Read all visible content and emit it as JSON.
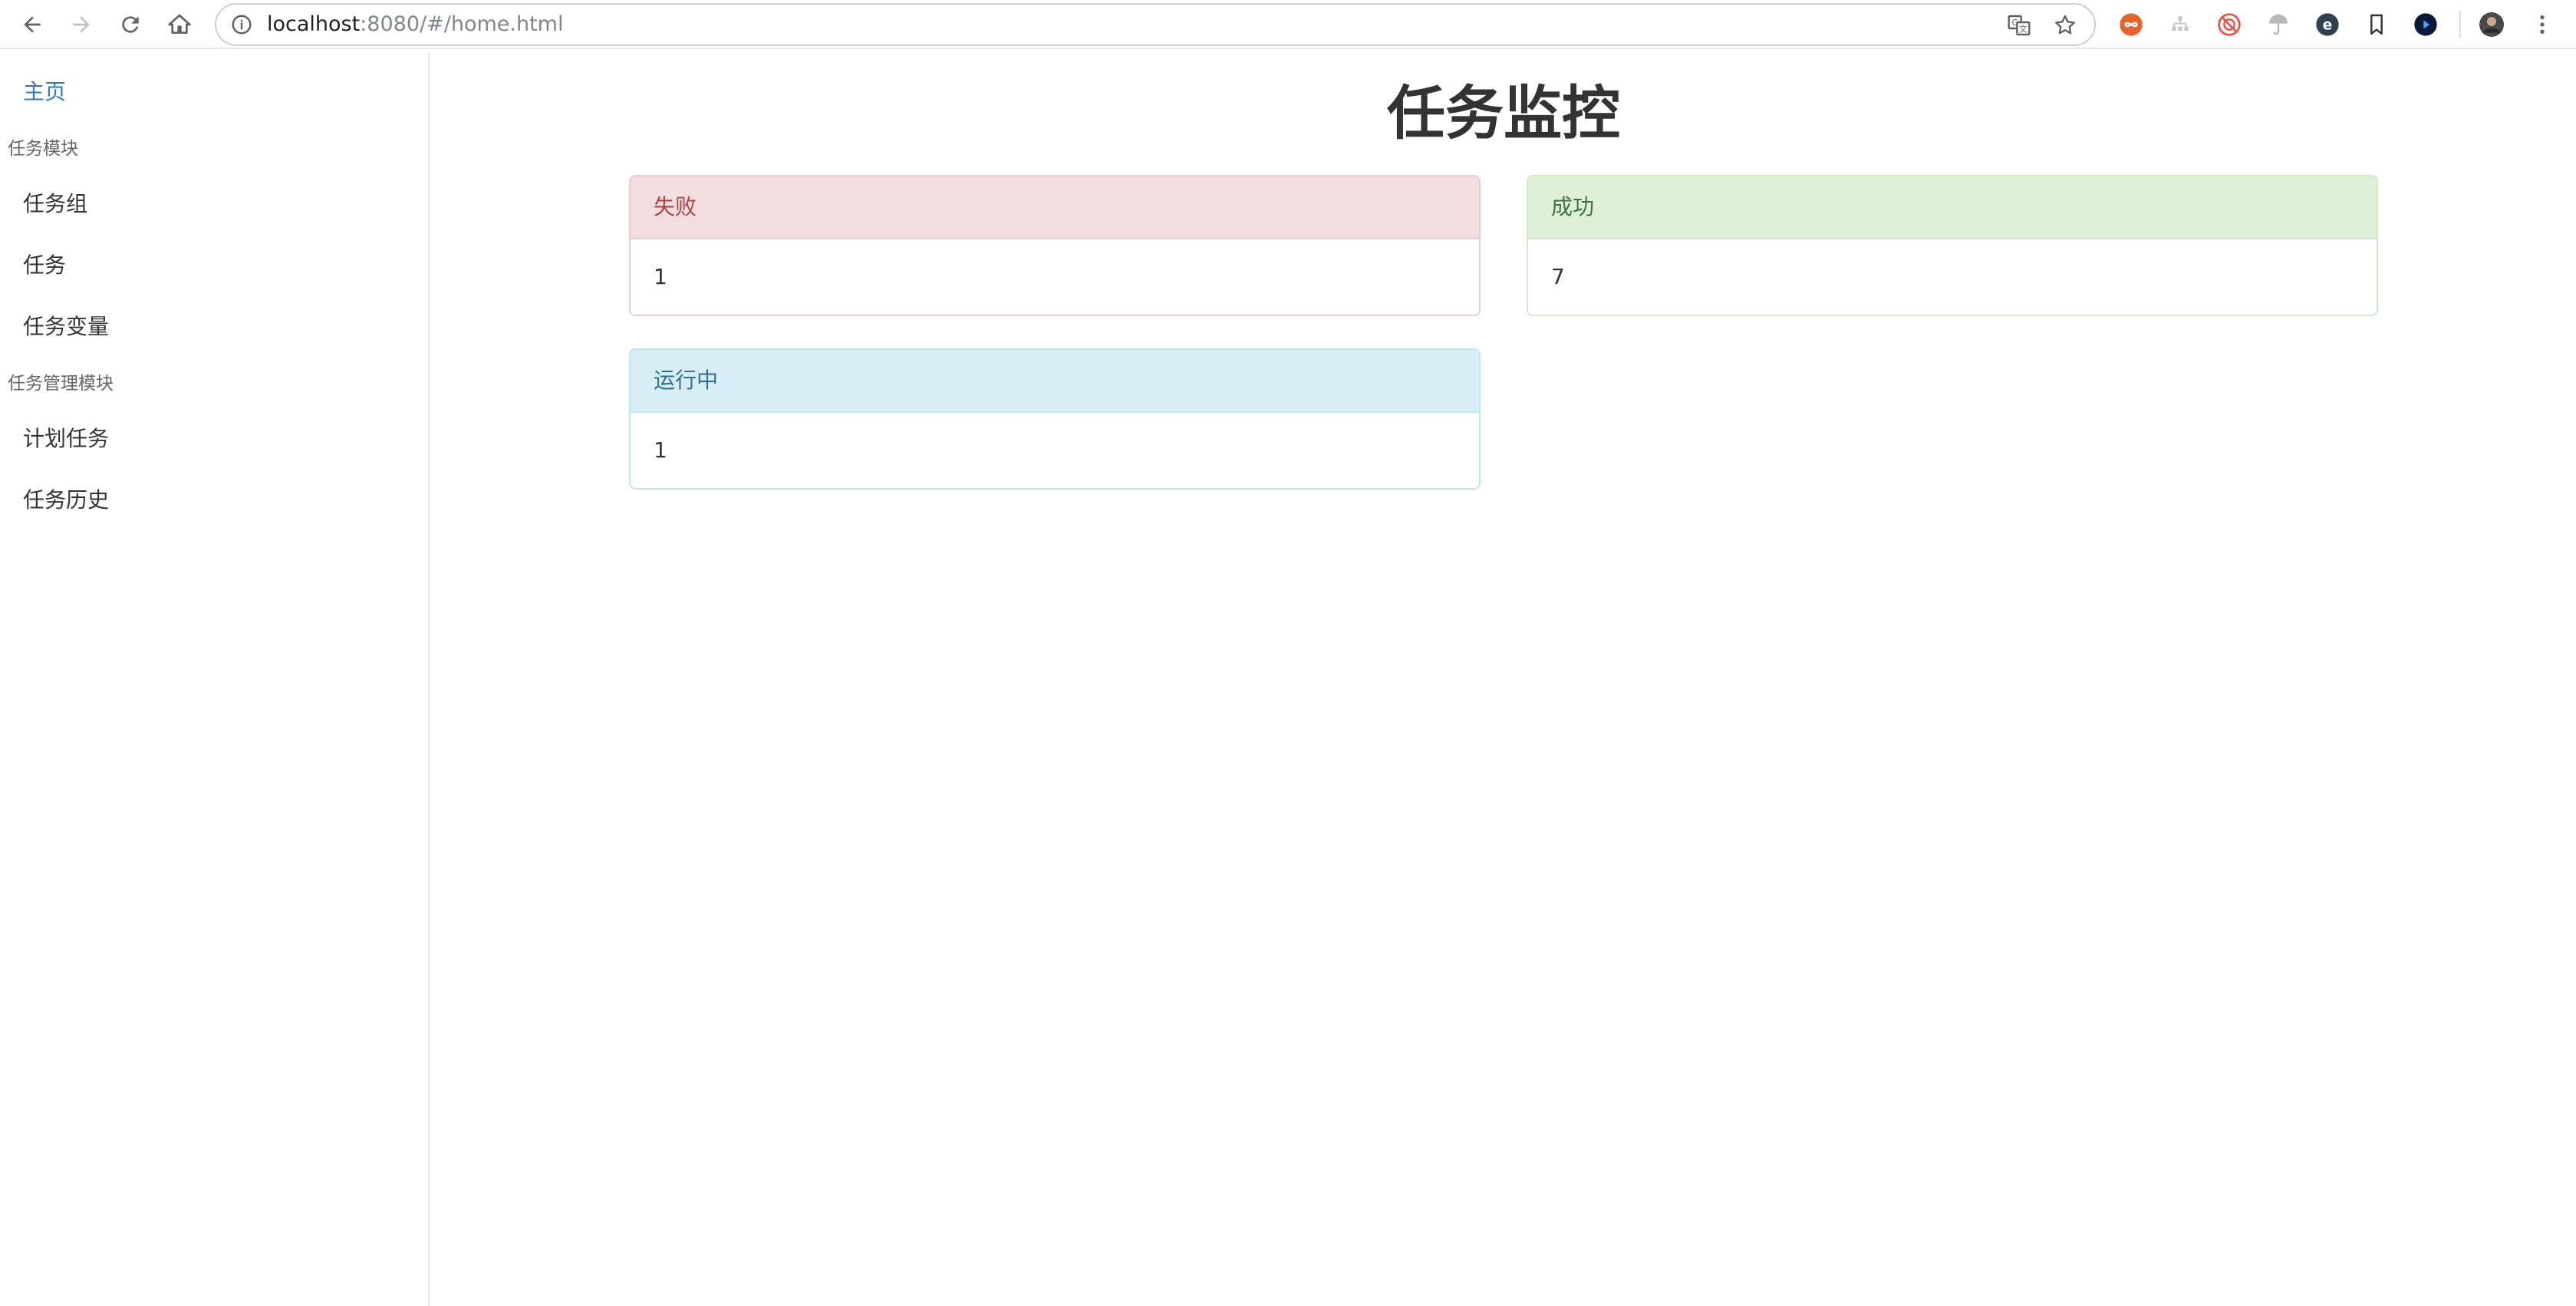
{
  "browser": {
    "url_host": "localhost",
    "url_rest": ":8080/#/home.html"
  },
  "sidebar": {
    "home_label": "主页",
    "sections": [
      {
        "header": "任务模块",
        "items": [
          {
            "label": "任务组"
          },
          {
            "label": "任务"
          },
          {
            "label": "任务变量"
          }
        ]
      },
      {
        "header": "任务管理模块",
        "items": [
          {
            "label": "计划任务"
          },
          {
            "label": "任务历史"
          }
        ]
      }
    ]
  },
  "main": {
    "title": "任务监控",
    "panels": [
      {
        "label": "失败",
        "value": "1",
        "status": "danger",
        "color": "#a94442"
      },
      {
        "label": "成功",
        "value": "7",
        "status": "success",
        "color": "#3c763d"
      },
      {
        "label": "运行中",
        "value": "1",
        "status": "info",
        "color": "#31708f"
      }
    ]
  },
  "icons": {
    "toolbar": [
      "back-icon",
      "forward-icon",
      "reload-icon",
      "home-icon"
    ],
    "omnibox": [
      "info-icon",
      "translate-icon",
      "star-icon"
    ],
    "extensions": [
      "infinity-extension-icon",
      "tree-extension-icon",
      "block-extension-icon",
      "umbrella-extension-icon",
      "e-extension-icon",
      "bookmark-extension-icon",
      "play-extension-icon",
      "avatar",
      "menu-icon"
    ]
  }
}
